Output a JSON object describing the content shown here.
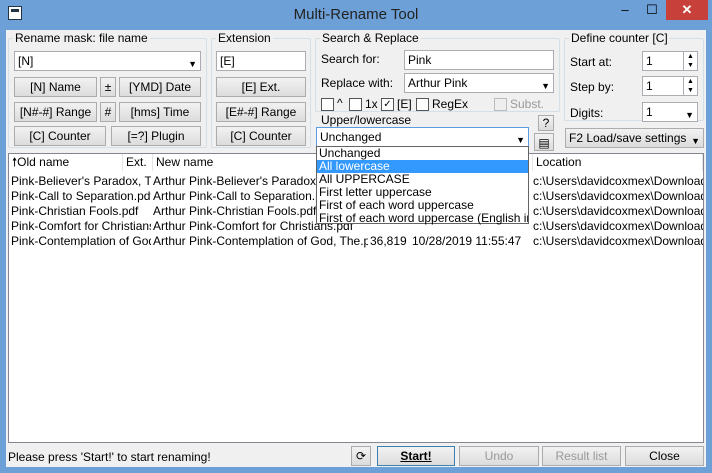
{
  "window": {
    "title": "Multi-Rename Tool",
    "minimize": "–",
    "maximize": "☐",
    "close": "✕"
  },
  "rename_mask": {
    "group_label": "Rename mask: file name",
    "value": "[N]",
    "buttons": {
      "name": "[N]  Name",
      "plus": "±",
      "ymd": "[YMD]  Date",
      "range": "[N#-#] Range",
      "hash": "#",
      "time": "[hms]  Time",
      "counter": "[C]  Counter",
      "plugin": "[=?]  Plugin"
    }
  },
  "extension": {
    "group_label": "Extension",
    "value": "[E]",
    "buttons": {
      "ext": "[E]  Ext.",
      "range": "[E#-#] Range",
      "counter": "[C]  Counter"
    }
  },
  "search_replace": {
    "group_label": "Search & Replace",
    "search_label": "Search for:",
    "search_value": "Pink",
    "replace_label": "Replace with:",
    "replace_value": "Arthur Pink",
    "opt_caret": "^",
    "opt_1x": "1x",
    "opt_e": "[E]",
    "opt_e_checked": "✓",
    "opt_regex": "RegEx",
    "opt_subst": "Subst."
  },
  "case": {
    "label": "Upper/lowercase",
    "help": "?",
    "value": "Unchanged",
    "options": [
      "Unchanged",
      "All lowercase",
      "All UPPERCASE",
      "First letter uppercase",
      "First of each word uppercase",
      "First of each word uppercase (English in Title"
    ],
    "selected_index": 1
  },
  "counter": {
    "group_label": "Define counter [C]",
    "start_label": "Start at:",
    "start_value": "1",
    "step_label": "Step by:",
    "step_value": "1",
    "digits_label": "Digits:",
    "digits_value": "1"
  },
  "load_save": "F2 Load/save settings",
  "columns": {
    "old": "Old name",
    "ext": "Ext.",
    "new": "New name",
    "location": "Location"
  },
  "rows": [
    {
      "old": "Pink-Believer's Paradox, The..",
      "new": "Arthur Pink-Believer's Paradox, The",
      "size": "",
      "date": "",
      "loc": "c:\\Users\\davidcoxmex\\Downloads\\l"
    },
    {
      "old": "Pink-Call to Separation.pdf",
      "new": "Arthur Pink-Call to Separation.pdf",
      "size": "",
      "date": "",
      "loc": "c:\\Users\\davidcoxmex\\Downloads\\l"
    },
    {
      "old": "Pink-Christian Fools.pdf",
      "new": "Arthur Pink-Christian Fools.pdf",
      "size": "",
      "date": "",
      "loc": "c:\\Users\\davidcoxmex\\Downloads\\l"
    },
    {
      "old": "Pink-Comfort for Christians.pdf",
      "new": "Arthur Pink-Comfort for Christians.pdf",
      "size": "",
      "date": "",
      "loc": "c:\\Users\\davidcoxmex\\Downloads\\l"
    },
    {
      "old": "Pink-Contemplation of God, ...",
      "new": "Arthur Pink-Contemplation of God, The.pdf",
      "size": "36,819",
      "date": "10/28/2019 11:55:47",
      "loc": "c:\\Users\\davidcoxmex\\Downloads\\l"
    }
  ],
  "footer": {
    "status": "Please press 'Start!' to start renaming!",
    "refresh": "⟳",
    "start": "Start!",
    "undo": "Undo",
    "result": "Result list",
    "close": "Close"
  }
}
